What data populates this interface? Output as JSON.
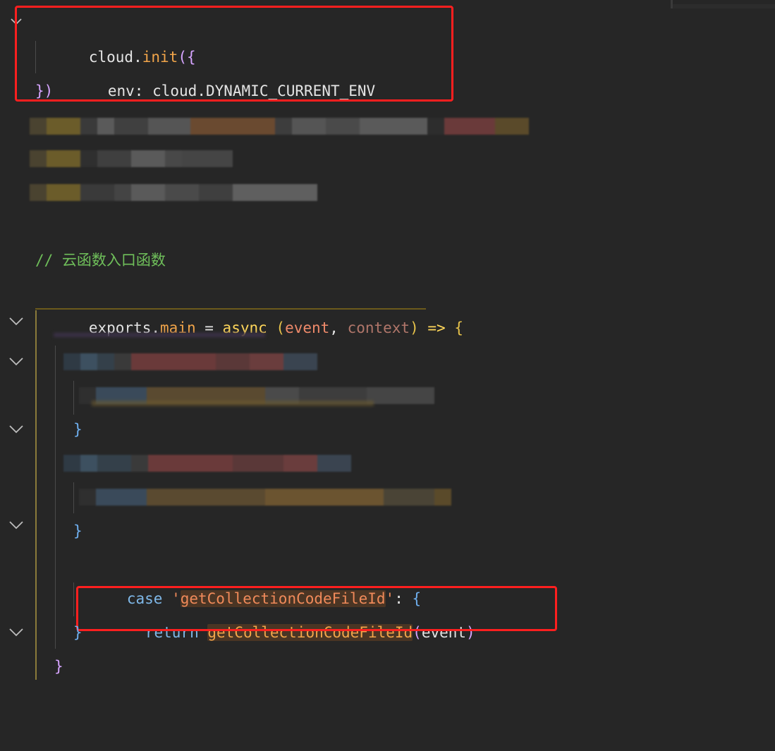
{
  "editor": {
    "lines": {
      "l1": {
        "obj": "cloud",
        "dot": ".",
        "fn": "init",
        "open": "({"
      },
      "l2": {
        "key": "env",
        "colon": ": ",
        "obj": "cloud",
        "dot": ".",
        "const": "DYNAMIC_CURRENT_ENV"
      },
      "l3": {
        "close": "})"
      },
      "comment": "// 云函数入口函数",
      "exports": {
        "obj": "exports",
        "dot": ".",
        "prop": "main",
        "eq": " = ",
        "kw": "async",
        "open": " (",
        "param1": "event",
        "comma": ", ",
        "param2": "context",
        "close": ")",
        "arrow": " => ",
        "brace": "{"
      },
      "switch": {
        "kw": "switch",
        "open": " (",
        "obj": "event",
        "dot": ".",
        "prop": "action",
        "close": ")",
        "brace": " {"
      },
      "close_brace_a": "}",
      "close_brace_b": "}",
      "case": {
        "kw": "case",
        "q1": " '",
        "str": "getCollectionCodeFileId",
        "q2": "'",
        "colon": ": ",
        "brace": "{"
      },
      "return": {
        "kw": "return",
        "fn": "getCollectionCodeFileId",
        "open": "(",
        "arg": "event",
        "close": ")"
      },
      "close_brace_c": "}",
      "close_brace_d": "}"
    }
  },
  "colors": {
    "background": "#262626",
    "highlight_box": "#ff1f1f"
  }
}
